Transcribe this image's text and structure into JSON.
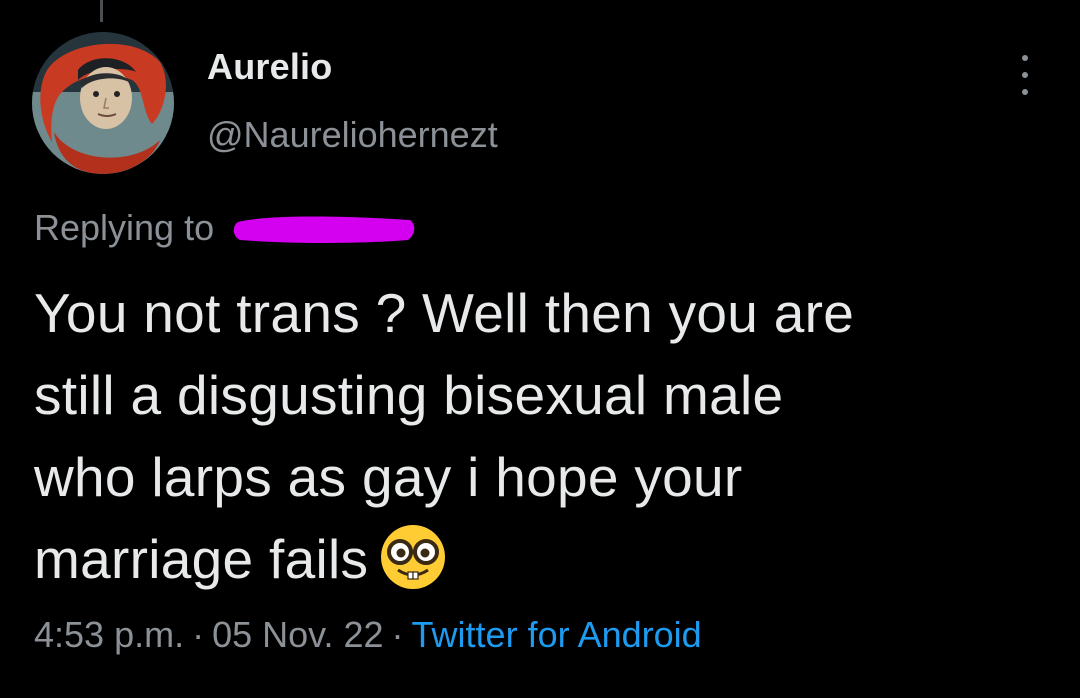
{
  "tweet": {
    "author": {
      "name": "Aurelio",
      "handle": "@Naureliohernezt"
    },
    "replying": {
      "label": "Replying to",
      "target_visible_fragment": "",
      "redaction_color": "#d400f0"
    },
    "text_lines": [
      "You not trans ? Well then you are",
      "still a disgusting bisexual male",
      "who larps as gay i hope your",
      "marriage fails"
    ],
    "emoji": "nerd-face",
    "meta": {
      "time": "4:53 p.m.",
      "separator": "·",
      "date": "05 Nov. 22",
      "source": "Twitter for Android"
    }
  },
  "colors": {
    "background": "#000000",
    "primary_text": "#e7e9ea",
    "secondary_text": "#8b9196",
    "link": "#1d9bf0"
  }
}
